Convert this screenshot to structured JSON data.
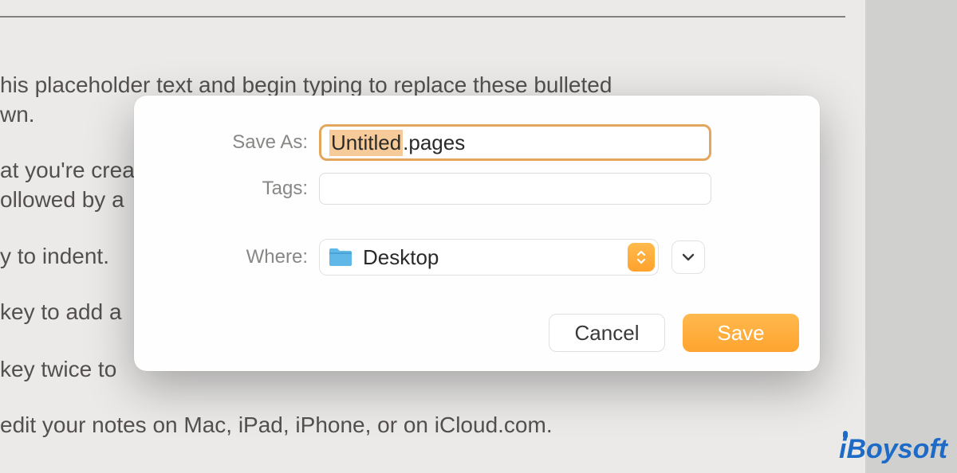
{
  "background": {
    "line1": "his placeholder text and begin typing to replace these bulleted",
    "line2": "wn.",
    "line3": "at you're crea",
    "line4": "ollowed by a",
    "line5": "y to indent.",
    "line6": "key to add a",
    "line7": "key twice to",
    "line8": " edit your notes on Mac, iPad, iPhone, or on iCloud.com."
  },
  "dialog": {
    "saveas": {
      "label": "Save As:",
      "filename_selected": "Untitled",
      "filename_ext": ".pages"
    },
    "tags": {
      "label": "Tags:",
      "value": ""
    },
    "where": {
      "label": "Where:",
      "selected": "Desktop"
    },
    "buttons": {
      "cancel": "Cancel",
      "save": "Save"
    }
  },
  "watermark": "iBoysoft"
}
